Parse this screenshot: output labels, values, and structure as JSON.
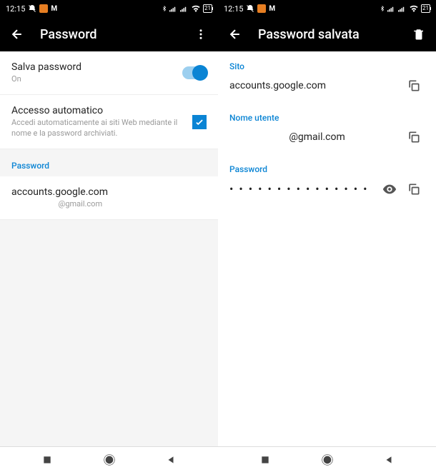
{
  "status": {
    "time": "12:15",
    "battery": "21"
  },
  "left": {
    "title": "Password",
    "savePassword": {
      "label": "Salva password",
      "state": "On"
    },
    "autoAccess": {
      "label": "Accesso automatico",
      "desc": "Accedi automaticamente ai siti Web mediante il nome e la password archiviati."
    },
    "sectionPassword": "Password",
    "entry": {
      "site": "accounts.google.com",
      "user": "@gmail.com"
    }
  },
  "right": {
    "title": "Password salvata",
    "siteLabel": "Sito",
    "siteValue": "accounts.google.com",
    "userLabel": "Nome utente",
    "userValue": "@gmail.com",
    "passwordLabel": "Password",
    "passwordMasked": "• • • • • • • • • • • • • • •"
  }
}
